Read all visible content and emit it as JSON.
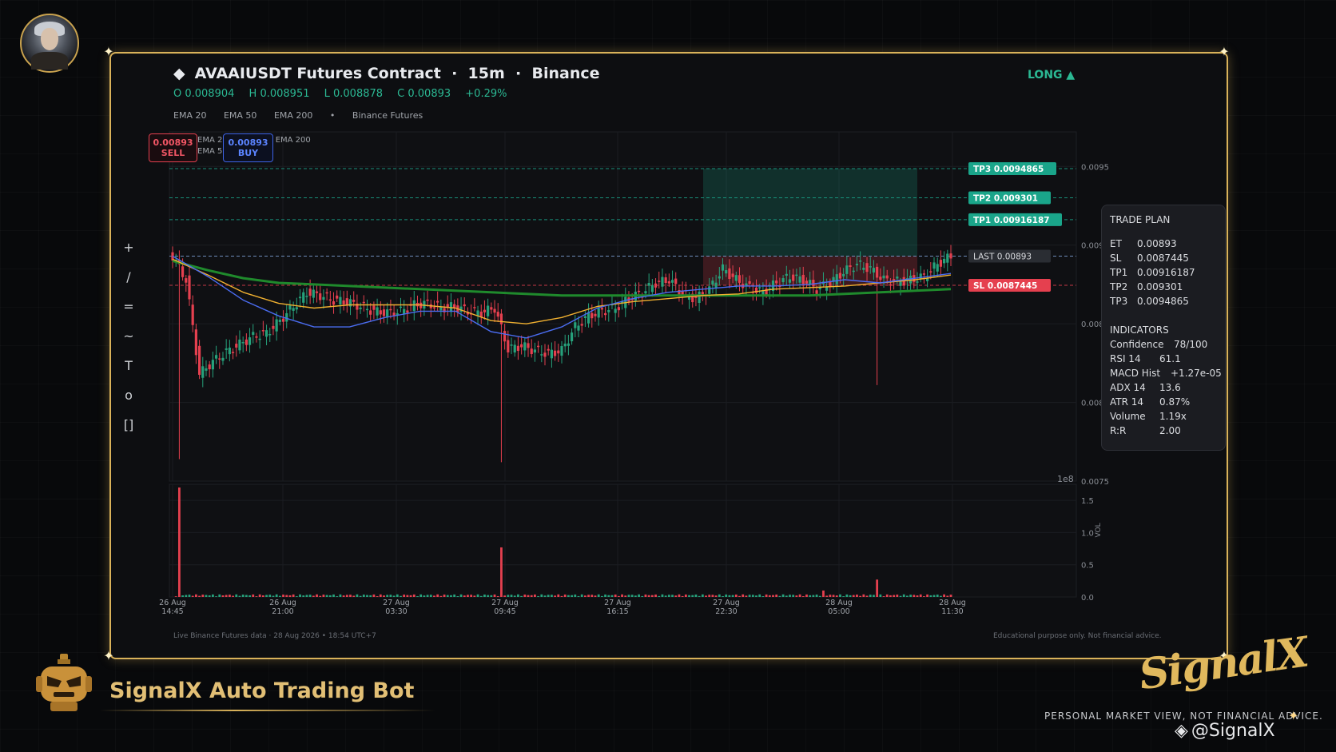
{
  "header": {
    "title": "AVAAIUSDT Futures Contract  ·  15m  ·  Binance",
    "ohlc": {
      "open": "O 0.008904",
      "high": "H 0.008951",
      "low": "L 0.008878",
      "close": "C 0.00893",
      "change": "+0.29%"
    },
    "emas": [
      "EMA 20",
      "EMA 50",
      "EMA 200",
      "•",
      "Binance Futures"
    ],
    "direction": "LONG ▲"
  },
  "quote": {
    "sell_price": "0.00893",
    "sell_label": "SELL",
    "buy_price": "0.00893",
    "buy_label": "BUY",
    "legend_line1": "EMA 20",
    "legend_line1_tail": "EMA 200",
    "legend_line2": "EMA 50"
  },
  "toolbar": {
    "items": [
      "+",
      "/",
      "=",
      "~",
      "T",
      "o",
      "[]"
    ]
  },
  "trade_plan": {
    "title": "TRADE PLAN",
    "et_label": "ET",
    "et": "0.00893",
    "sl_label": "SL",
    "sl": "0.0087445",
    "tp1_label": "TP1",
    "tp1": "0.00916187",
    "tp2_label": "TP2",
    "tp2": "0.009301",
    "tp3_label": "TP3",
    "tp3": "0.0094865"
  },
  "indicators": {
    "title": "INDICATORS",
    "confidence_label": "Confidence",
    "confidence": "78/100",
    "rsi_label": "RSI 14",
    "rsi": "61.1",
    "macd_label": "MACD Hist",
    "macd": "+1.27e-05",
    "adx_label": "ADX 14",
    "adx": "13.6",
    "atr_label": "ATR 14",
    "atr": "0.87%",
    "volume_label": "Volume",
    "volume": "1.19x",
    "rr_label": "R:R",
    "rr": "2.00"
  },
  "footer": {
    "left": "Live Binance Futures data  ·  28 Aug 2026 • 18:54 UTC+7",
    "right": "Educational purpose only. Not financial advice."
  },
  "branding": {
    "bot_title": "SignalX Auto Trading Bot",
    "logo_text": "SignalX",
    "tagline": "PERSONAL MARKET VIEW, NOT FINANCIAL ADVICE.",
    "handle": "@SignalX"
  },
  "colors": {
    "up": "#26a17b",
    "down": "#e5404f",
    "tp": "#1aa58a",
    "sl": "#e5404f",
    "ema20": "#4a6cf0",
    "ema50": "#f0b030",
    "ema200": "#1f8a2c",
    "accent": "#d9b25a"
  },
  "chart_data": {
    "type": "candlestick",
    "price_axis": {
      "ticks": [
        "0.0095",
        "0.009",
        "0.0085",
        "0.008",
        "0.0075"
      ],
      "offset_label": "1e8",
      "ylim": [
        0.0075,
        0.00972
      ]
    },
    "x_ticks": [
      {
        "date": "26 Aug",
        "time": "14:45"
      },
      {
        "date": "26 Aug",
        "time": "21:00"
      },
      {
        "date": "27 Aug",
        "time": "03:30"
      },
      {
        "date": "27 Aug",
        "time": "09:45"
      },
      {
        "date": "27 Aug",
        "time": "16:15"
      },
      {
        "date": "27 Aug",
        "time": "22:30"
      },
      {
        "date": "28 Aug",
        "time": "05:00"
      },
      {
        "date": "28 Aug",
        "time": "11:30"
      }
    ],
    "levels": [
      {
        "name": "TP3",
        "value": 0.0094865,
        "label": "TP3  0.0094865"
      },
      {
        "name": "TP2",
        "value": 0.009301,
        "label": "TP2  0.009301"
      },
      {
        "name": "TP1",
        "value": 0.00916187,
        "label": "TP1  0.00916187"
      },
      {
        "name": "LAST",
        "value": 0.00893,
        "label": "LAST  0.00893"
      },
      {
        "name": "SL",
        "value": 0.0087445,
        "label": "SL  0.0087445"
      }
    ],
    "trade_zone": {
      "entry": 0.00893,
      "stop": 0.0087445,
      "target": 0.0094865
    },
    "close_path": [
      0.00893,
      0.00878,
      0.00818,
      0.00826,
      0.00832,
      0.00837,
      0.00842,
      0.00844,
      0.00852,
      0.00861,
      0.0087,
      0.00868,
      0.00865,
      0.00864,
      0.00861,
      0.00858,
      0.00857,
      0.00858,
      0.00862,
      0.00863,
      0.0086,
      0.00861,
      0.00858,
      0.00857,
      0.0086,
      0.00834,
      0.00836,
      0.00833,
      0.00831,
      0.00833,
      0.00848,
      0.00855,
      0.00858,
      0.0086,
      0.00866,
      0.0087,
      0.00876,
      0.00878,
      0.00869,
      0.00866,
      0.00872,
      0.00885,
      0.00878,
      0.00873,
      0.0087,
      0.00876,
      0.0088,
      0.00878,
      0.00872,
      0.00876,
      0.00883,
      0.00888,
      0.00885,
      0.00878,
      0.00877,
      0.00878,
      0.0088,
      0.00888,
      0.00893
    ],
    "ema20": [
      0.00893,
      0.0088,
      0.00865,
      0.00855,
      0.00848,
      0.00848,
      0.00854,
      0.00858,
      0.00858,
      0.00845,
      0.00841,
      0.00848,
      0.0086,
      0.00866,
      0.0087,
      0.00872,
      0.00874,
      0.00874,
      0.00875,
      0.00878,
      0.00876,
      0.00879,
      0.00882
    ],
    "ema50": [
      0.00891,
      0.00881,
      0.0087,
      0.00863,
      0.0086,
      0.00862,
      0.00862,
      0.00862,
      0.0086,
      0.00852,
      0.0085,
      0.00854,
      0.00861,
      0.00864,
      0.00866,
      0.00868,
      0.00869,
      0.00872,
      0.00873,
      0.00874,
      0.00876,
      0.00878,
      0.00881
    ],
    "ema200": [
      0.0089,
      0.00884,
      0.00879,
      0.00876,
      0.00875,
      0.00874,
      0.00873,
      0.00872,
      0.00871,
      0.0087,
      0.00869,
      0.00868,
      0.00868,
      0.00868,
      0.00868,
      0.00868,
      0.00868,
      0.00868,
      0.00868,
      0.00869,
      0.0087,
      0.00871,
      0.00872
    ],
    "spikes": [
      {
        "index": 1,
        "low": 0.00764
      },
      {
        "index": 25,
        "low": 0.00762
      },
      {
        "index": 53,
        "low": 0.00811
      }
    ],
    "volume": {
      "label": "VOL",
      "ticks": [
        "1.5",
        "1.0",
        "0.5",
        "0.0"
      ],
      "ylim": [
        0,
        1.75
      ],
      "spikes": [
        {
          "index": 1,
          "value": 1.7
        },
        {
          "index": 25,
          "value": 0.77
        },
        {
          "index": 53,
          "value": 0.27
        },
        {
          "index": 49,
          "value": 0.1
        }
      ]
    }
  }
}
